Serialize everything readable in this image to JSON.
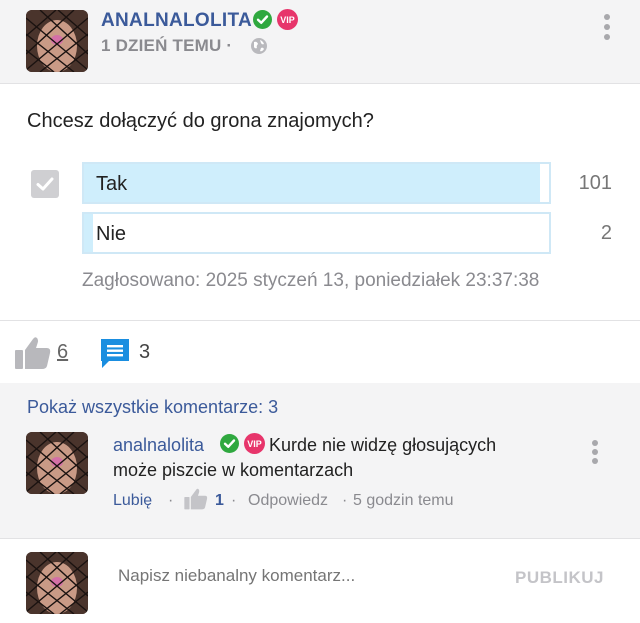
{
  "post": {
    "author": "ANALNALOLITA",
    "vip_badge": "VIP",
    "time": "1 DZIEŃ TEMU ·",
    "verified_icon": "check-circle-icon",
    "visibility_icon": "globe-icon"
  },
  "poll": {
    "question": "Chcesz dołączyć do grona znajomych?",
    "options": [
      {
        "label": "Tak",
        "votes": "101",
        "share": 0.98,
        "selected": true
      },
      {
        "label": "Nie",
        "votes": "2",
        "share": 0.02,
        "selected": false
      }
    ],
    "voted_text": "Zagłosowano: 2025 styczeń 13, poniedziałek 23:37:38"
  },
  "actions": {
    "likes": "6",
    "comments": "3",
    "like_icon": "thumbs-up-icon",
    "comment_icon": "comment-icon"
  },
  "comments": {
    "show_all": "Pokaż wszystkie komentarze: 3",
    "items": [
      {
        "author": "analnalolita",
        "vip_badge": "VIP",
        "text_line1": "Kurde nie widzę głosujących",
        "text_line2": "może piszcie w komentarzach",
        "like_label": "Lubię",
        "sep1": "·",
        "like_count": "1",
        "sep2": "·",
        "reply_label": "Odpowiedz",
        "sep3": "·",
        "time": "5 godzin temu"
      }
    ]
  },
  "compose": {
    "placeholder": "Napisz niebanalny komentarz...",
    "publish_label": "PUBLIKUJ"
  },
  "colors": {
    "accent": "#3b5a9a",
    "verified": "#2fa83f",
    "vip": "#e7356b",
    "comment_icon": "#1a8ee0",
    "poll_fill": "#cfeefc"
  }
}
